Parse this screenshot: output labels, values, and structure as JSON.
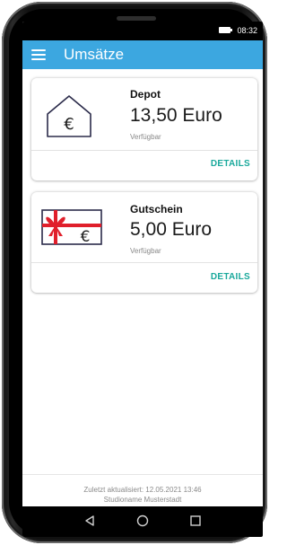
{
  "status_bar": {
    "time": "08:32",
    "battery_icon": "battery-icon"
  },
  "app_bar": {
    "title": "Umsätze",
    "menu_icon": "hamburger-menu-icon",
    "color": "#3ca7e0"
  },
  "cards": [
    {
      "title": "Depot",
      "amount": "13,50 Euro",
      "subtitle": "Verfügbar",
      "action": "DETAILS",
      "icon": "house-euro-icon"
    },
    {
      "title": "Gutschein",
      "amount": "5,00 Euro",
      "subtitle": "Verfügbar",
      "action": "DETAILS",
      "icon": "gift-voucher-euro-icon"
    }
  ],
  "footer": {
    "updated": "Zuletzt aktualisiert: 12.05.2021 13:46",
    "studio": "Studioname Musterstadt"
  },
  "nav_bar": {
    "back_icon": "back-triangle-icon",
    "home_icon": "home-circle-icon",
    "recents_icon": "recents-square-icon"
  },
  "accent_color": "#1aa99c"
}
